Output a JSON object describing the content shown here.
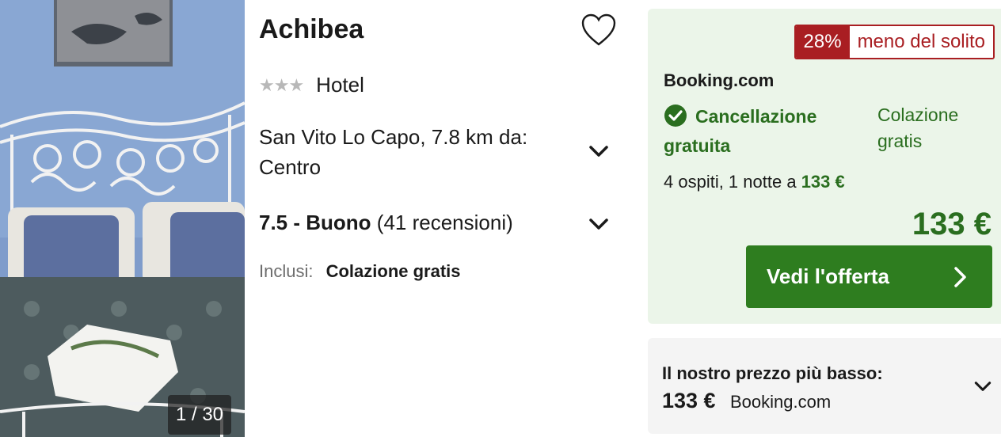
{
  "photo": {
    "counter": "1 / 30",
    "alt": "hotel-room-photo"
  },
  "hotel": {
    "name": "Achibea",
    "stars": "★★★",
    "type": "Hotel",
    "location": "San Vito Lo Capo, 7.8 km da: Centro",
    "rating_score": "7.5 - Buono",
    "rating_count": "(41 recensioni)",
    "included_label": "Inclusi:",
    "included_value": "Colazione gratis"
  },
  "offer": {
    "deal_percent": "28%",
    "deal_text": "meno del solito",
    "provider": "Booking.com",
    "cancellation": "Cancellazione gratuita",
    "breakfast": "Colazione gratis",
    "guests_text": "4 ospiti, 1 notte a",
    "guests_price": "133 €",
    "price": "133 €",
    "cta_label": "Vedi l'offerta"
  },
  "lowest": {
    "title": "Il nostro prezzo più basso:",
    "price": "133 €",
    "provider": "Booking.com"
  },
  "colors": {
    "accent_green": "#2e7d1f",
    "deal_red": "#a91e22",
    "offer_bg": "#ebf5e9"
  }
}
